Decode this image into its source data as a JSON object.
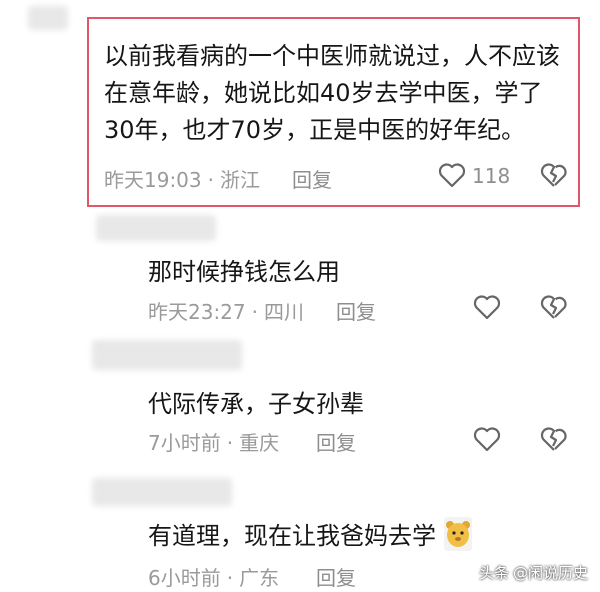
{
  "comments": [
    {
      "text_lines": [
        "以前我看病的一个中医师就说过，人不应该",
        "在意年龄，她说比如40岁去学中医，学了",
        "30年，也才70岁，正是中医的好年纪。"
      ],
      "time": "昨天19:03",
      "location": "浙江",
      "reply_label": "回复",
      "likes": "118"
    },
    {
      "text": "那时候挣钱怎么用",
      "time": "昨天23:27",
      "location": "四川",
      "reply_label": "回复"
    },
    {
      "text": "代际传承，子女孙辈",
      "time": "7小时前",
      "location": "重庆",
      "reply_label": "回复"
    },
    {
      "text": "有道理，现在让我爸妈去学",
      "time": "6小时前",
      "location": "广东",
      "reply_label": "回复"
    }
  ],
  "watermark": {
    "brand": "头条",
    "account": "@闲说历史"
  },
  "colors": {
    "highlight_border": "#e2566a",
    "meta_gray": "#9a9a9a"
  }
}
